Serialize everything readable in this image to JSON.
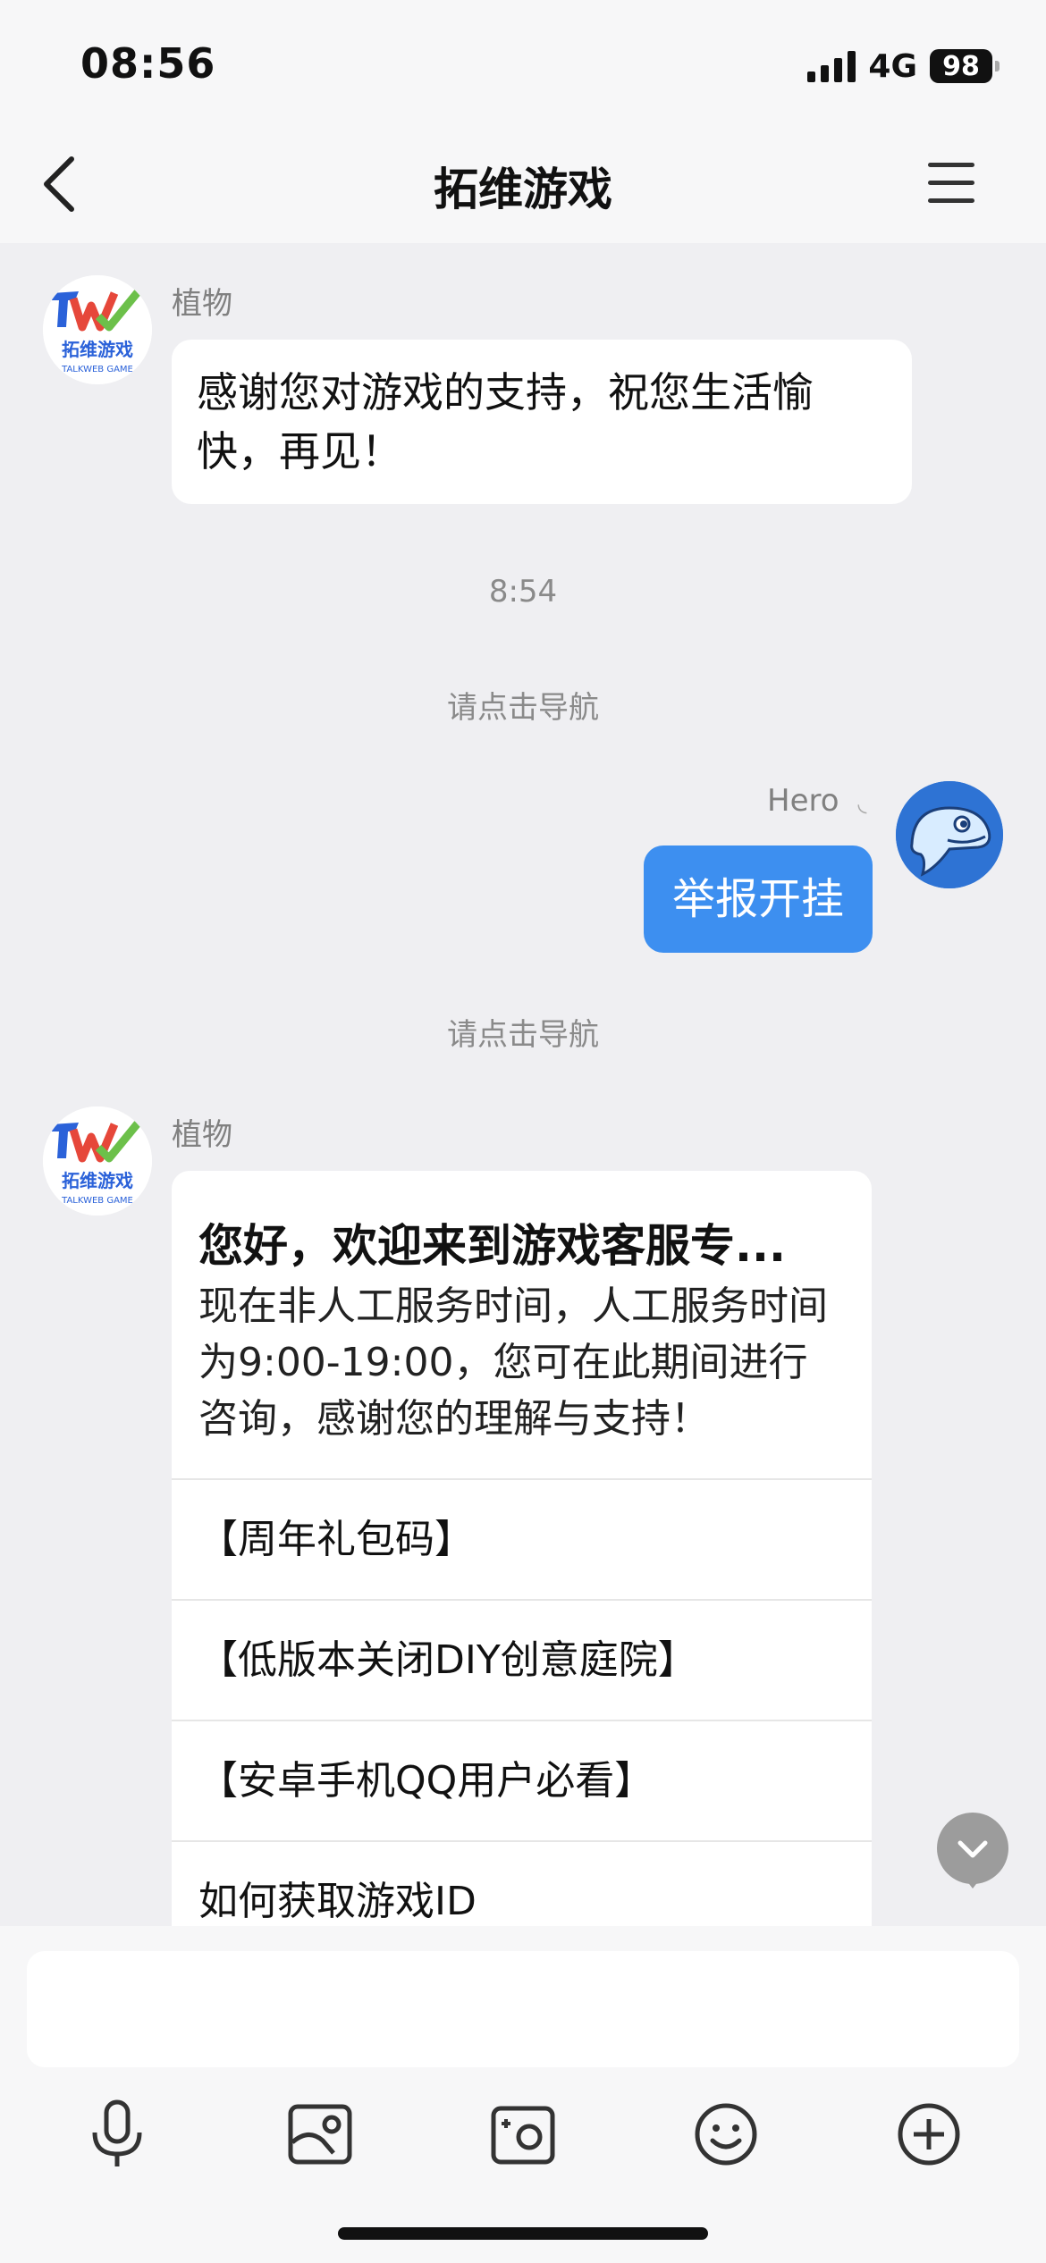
{
  "status": {
    "time": "08:56",
    "network": "4G",
    "battery": "98"
  },
  "nav": {
    "title": "拓维游戏"
  },
  "messages": {
    "m1": {
      "sender": "植物",
      "text": "感谢您对游戏的支持，祝您生活愉快，再见！"
    },
    "time1": "8:54",
    "tip1": "请点击导航",
    "m2": {
      "sender": "Hero",
      "text": "举报开挂"
    },
    "tip2": "请点击导航",
    "m3": {
      "sender": "植物",
      "title": "您好，欢迎来到游戏客服专...",
      "body": "现在非人工服务时间，人工服务时间为9:00-19:00，您可在此期间进行咨询，感谢您的理解与支持！",
      "items": [
        "【周年礼包码】",
        "【低版本关闭DIY创意庭院】",
        "【安卓手机QQ用户必看】",
        "如何获取游戏ID"
      ]
    }
  },
  "avatar_logo": {
    "letters": "TW",
    "caption": "拓维游戏",
    "sub": "TALKWEB GAME"
  },
  "input": {
    "placeholder": ""
  },
  "toolbar": [
    "microphone-icon",
    "image-icon",
    "camera-icon",
    "emoji-icon",
    "plus-icon"
  ],
  "colors": {
    "accent": "#3d8ff0",
    "background": "#efeff2"
  }
}
